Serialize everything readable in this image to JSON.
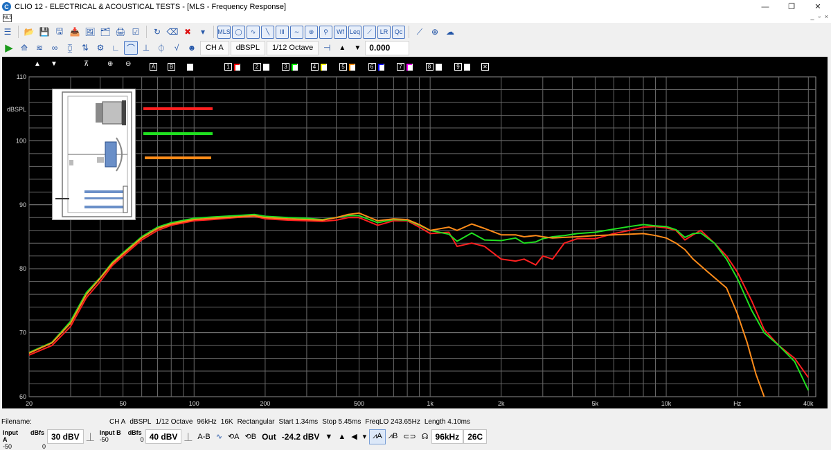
{
  "window": {
    "title": "CLIO 12 - ELECTRICAL & ACOUSTICAL TESTS - [MLS - Frequency Response]",
    "app_icon_letter": "C",
    "min_glyph": "—",
    "restore_glyph": "❐",
    "close_glyph": "✕"
  },
  "menubar": {
    "doc_icon_text": "MLS",
    "mdi_min": "_",
    "mdi_restore": "▫",
    "mdi_close": "×"
  },
  "toolbar1": {
    "icons": [
      "menu-icon",
      "open-folder-icon",
      "save-icon",
      "save-as-icon",
      "export-icon",
      "image-icon",
      "clipboard-icon",
      "print-icon",
      "check-icon",
      "undo-icon",
      "eraser-icon",
      "delete-icon",
      "dropdown-icon",
      "mls-icon",
      "sinusoid-icon",
      "fft-icon",
      "sweep-icon",
      "bargraph-icon",
      "waveform-icon",
      "polar-icon",
      "filter-icon",
      "wf-icon",
      "leq-icon",
      "meter-icon",
      "lr-icon",
      "qc-icon",
      "ruler-icon",
      "help-icon",
      "cloud-icon"
    ],
    "glyphs": [
      "☰",
      "📂",
      "💾",
      "🖫",
      "📥",
      "🖼",
      "🗂",
      "🖨",
      "☑",
      "↻",
      "⌫",
      "✖",
      "▾",
      "MLS",
      "◯",
      "∿",
      "╲",
      "lll",
      "∼",
      "⊛",
      "⚲",
      "Wf",
      "Leq",
      "⟋",
      "LR",
      "Qc",
      "⟋",
      "⊕",
      "☁"
    ]
  },
  "toolbar2": {
    "go": "▶",
    "glyphs": [
      "⟰",
      "≋",
      "∞",
      "⧮",
      "⇅",
      "⚙",
      "∟",
      "⌒",
      "⊥",
      "⏀",
      "√",
      "☻"
    ],
    "channel": "CH A",
    "unit": "dBSPL",
    "smoothing": "1/12 Octave",
    "marker_glyph": "⊣",
    "up_glyph": "▲",
    "down_glyph": "▼",
    "value": "0.000"
  },
  "plot_toolbar": {
    "tools": [
      "▲",
      "▼",
      "⊼",
      "⊕",
      "⊖"
    ],
    "tool_names": [
      "up-arrow-icon",
      "down-arrow-icon",
      "zoom-fit-icon",
      "zoom-in-icon",
      "zoom-out-icon"
    ],
    "boxes": [
      "A",
      "B"
    ],
    "overlays": [
      "1",
      "2",
      "3",
      "4",
      "5",
      "6",
      "7",
      "8",
      "9"
    ],
    "overlay_colors": [
      "#ff0000",
      "#ffffff",
      "#00ff00",
      "#ffff00",
      "#ff8c00",
      "#0000ff",
      "#ff00ff",
      "#ffffff",
      "#ffffff"
    ],
    "clear": "✕"
  },
  "chart_data": {
    "type": "line",
    "ylabel": "dBSPL",
    "x_scale": "log",
    "xlim": [
      20,
      43000
    ],
    "ylim": [
      60,
      110
    ],
    "yticks": [
      60,
      70,
      80,
      90,
      100,
      110
    ],
    "xticks": [
      {
        "v": 20,
        "label": "20"
      },
      {
        "v": 50,
        "label": "50"
      },
      {
        "v": 100,
        "label": "100"
      },
      {
        "v": 200,
        "label": "200"
      },
      {
        "v": 500,
        "label": "500"
      },
      {
        "v": 1000,
        "label": "1k"
      },
      {
        "v": 2000,
        "label": "2k"
      },
      {
        "v": 5000,
        "label": "5k"
      },
      {
        "v": 10000,
        "label": "10k"
      },
      {
        "v": 20000,
        "label": "Hz"
      },
      {
        "v": 40000,
        "label": "40k"
      }
    ],
    "grid": true,
    "series": [
      {
        "color": "#ff2020",
        "points": [
          [
            20,
            66.5
          ],
          [
            25,
            68
          ],
          [
            30,
            71
          ],
          [
            35,
            75.5
          ],
          [
            40,
            78
          ],
          [
            45,
            80.5
          ],
          [
            50,
            82
          ],
          [
            60,
            84.5
          ],
          [
            70,
            86
          ],
          [
            80,
            86.8
          ],
          [
            100,
            87.5
          ],
          [
            120,
            87.7
          ],
          [
            150,
            88
          ],
          [
            180,
            88.2
          ],
          [
            200,
            87.8
          ],
          [
            250,
            87.6
          ],
          [
            300,
            87.5
          ],
          [
            350,
            87.4
          ],
          [
            400,
            87.6
          ],
          [
            450,
            88
          ],
          [
            500,
            88
          ],
          [
            600,
            86.8
          ],
          [
            700,
            87.5
          ],
          [
            800,
            87.5
          ],
          [
            900,
            86.5
          ],
          [
            1000,
            85.5
          ],
          [
            1200,
            85.7
          ],
          [
            1300,
            83.5
          ],
          [
            1500,
            84
          ],
          [
            1700,
            83.5
          ],
          [
            2000,
            81.5
          ],
          [
            2300,
            81.2
          ],
          [
            2500,
            81.5
          ],
          [
            2800,
            80.6
          ],
          [
            3000,
            82
          ],
          [
            3300,
            81.5
          ],
          [
            3700,
            84
          ],
          [
            4200,
            84.7
          ],
          [
            5000,
            84.7
          ],
          [
            6000,
            85.5
          ],
          [
            7000,
            86
          ],
          [
            8000,
            86.5
          ],
          [
            9000,
            86.6
          ],
          [
            10000,
            86.4
          ],
          [
            11000,
            86
          ],
          [
            12000,
            84.5
          ],
          [
            13000,
            85.3
          ],
          [
            14000,
            86
          ],
          [
            16000,
            84
          ],
          [
            18000,
            82
          ],
          [
            20000,
            79.5
          ],
          [
            23000,
            75
          ],
          [
            26000,
            70.5
          ],
          [
            30000,
            68
          ],
          [
            35000,
            66
          ],
          [
            40000,
            63
          ]
        ]
      },
      {
        "color": "#20e020",
        "points": [
          [
            20,
            66.9
          ],
          [
            25,
            68.5
          ],
          [
            30,
            71.8
          ],
          [
            35,
            76.3
          ],
          [
            40,
            78.6
          ],
          [
            45,
            81
          ],
          [
            50,
            82.5
          ],
          [
            60,
            85
          ],
          [
            70,
            86.5
          ],
          [
            80,
            87.2
          ],
          [
            100,
            87.9
          ],
          [
            120,
            88.1
          ],
          [
            150,
            88.3
          ],
          [
            180,
            88.5
          ],
          [
            200,
            88.2
          ],
          [
            250,
            88
          ],
          [
            300,
            87.9
          ],
          [
            350,
            87.7
          ],
          [
            400,
            88
          ],
          [
            450,
            88.3
          ],
          [
            500,
            88.3
          ],
          [
            600,
            87.2
          ],
          [
            700,
            87.7
          ],
          [
            800,
            87.6
          ],
          [
            900,
            86.8
          ],
          [
            1000,
            86
          ],
          [
            1200,
            85.4
          ],
          [
            1300,
            84.3
          ],
          [
            1500,
            85.6
          ],
          [
            1700,
            84.5
          ],
          [
            2000,
            84.4
          ],
          [
            2300,
            84.8
          ],
          [
            2500,
            84
          ],
          [
            2800,
            84.2
          ],
          [
            3000,
            84.7
          ],
          [
            3300,
            85
          ],
          [
            3700,
            85.2
          ],
          [
            4200,
            85.5
          ],
          [
            5000,
            85.7
          ],
          [
            6000,
            86.2
          ],
          [
            7000,
            86.6
          ],
          [
            8000,
            86.9
          ],
          [
            9000,
            86.7
          ],
          [
            10000,
            86.6
          ],
          [
            11000,
            86.1
          ],
          [
            12000,
            84.9
          ],
          [
            13000,
            85.5
          ],
          [
            14000,
            85.6
          ],
          [
            16000,
            84
          ],
          [
            18000,
            81.5
          ],
          [
            20000,
            78.5
          ],
          [
            23000,
            73.5
          ],
          [
            26000,
            70
          ],
          [
            30000,
            68
          ],
          [
            35000,
            65.5
          ],
          [
            40000,
            61
          ]
        ]
      },
      {
        "color": "#ff8c1a",
        "points": [
          [
            20,
            66.8
          ],
          [
            25,
            68.4
          ],
          [
            30,
            71.5
          ],
          [
            35,
            76
          ],
          [
            40,
            78.5
          ],
          [
            45,
            80.8
          ],
          [
            50,
            82.3
          ],
          [
            60,
            84.8
          ],
          [
            70,
            86.3
          ],
          [
            80,
            87
          ],
          [
            100,
            87.7
          ],
          [
            120,
            87.9
          ],
          [
            150,
            88.1
          ],
          [
            180,
            88.3
          ],
          [
            200,
            88
          ],
          [
            250,
            87.8
          ],
          [
            300,
            87.7
          ],
          [
            350,
            87.6
          ],
          [
            400,
            88
          ],
          [
            450,
            88.5
          ],
          [
            500,
            88.7
          ],
          [
            600,
            87.5
          ],
          [
            700,
            87.8
          ],
          [
            800,
            87.7
          ],
          [
            900,
            86.9
          ],
          [
            1000,
            86
          ],
          [
            1200,
            86.5
          ],
          [
            1300,
            86
          ],
          [
            1500,
            87
          ],
          [
            1700,
            86.3
          ],
          [
            2000,
            85.3
          ],
          [
            2300,
            85.3
          ],
          [
            2500,
            85
          ],
          [
            2800,
            85.2
          ],
          [
            3000,
            85
          ],
          [
            3300,
            84.8
          ],
          [
            3700,
            84.9
          ],
          [
            4200,
            85
          ],
          [
            5000,
            85.2
          ],
          [
            6000,
            85.3
          ],
          [
            7000,
            85.4
          ],
          [
            8000,
            85.5
          ],
          [
            9000,
            85.2
          ],
          [
            10000,
            84.8
          ],
          [
            11000,
            84
          ],
          [
            12000,
            83
          ],
          [
            13000,
            81.5
          ],
          [
            15000,
            79.5
          ],
          [
            18000,
            77
          ],
          [
            20000,
            73
          ],
          [
            22000,
            68.5
          ],
          [
            24000,
            63.5
          ],
          [
            26000,
            60
          ]
        ]
      }
    ]
  },
  "statusbar": {
    "filename_label": "Filename:",
    "info": [
      "CH A",
      "dBSPL",
      "1/12 Octave",
      "96kHz",
      "16K",
      "Rectangular",
      "Start 1.34ms",
      "Stop 5.45ms",
      "FreqLO 243.65Hz",
      "Length 4.10ms"
    ]
  },
  "bottombar": {
    "input_a_label": "Input A",
    "input_b_label": "Input B",
    "dbfs_label": "dBfs",
    "scale_min": "-50",
    "scale_max": "0",
    "input_a_value": "30 dBV",
    "input_b_value": "40 dBV",
    "ab_label": "A-B",
    "out_label": "Out",
    "out_value": "-24.2 dBV",
    "sample_rate": "96kHz",
    "temperature": "26C"
  }
}
